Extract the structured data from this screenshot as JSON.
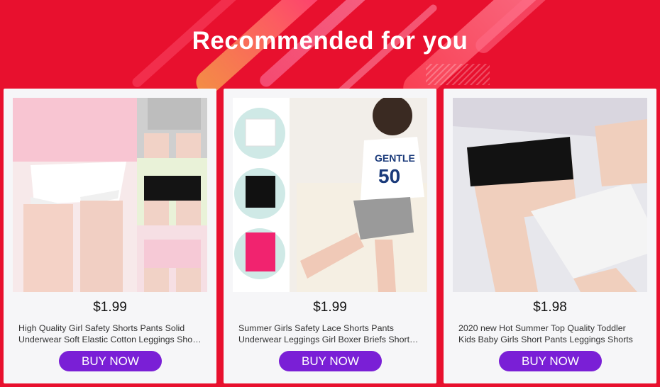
{
  "header": {
    "title": "Recommended for you"
  },
  "products": [
    {
      "price": "$1.99",
      "name": "High Quality Girl Safety Shorts Pants Solid Underwear Soft Elastic Cotton Leggings Short Pants",
      "button_label": "BUY NOW",
      "image_alt": "lace-trim safety shorts in white, grey, black, pink"
    },
    {
      "price": "$1.99",
      "name": "Summer Girls Safety Lace Shorts Pants Underwear Leggings Girl Boxer Briefs Short Pants",
      "button_label": "BUY NOW",
      "image_alt": "girl wearing grey shorts with white, black, pink variants"
    },
    {
      "price": "$1.98",
      "name": "2020 new Hot Summer Top Quality Toddler Kids Baby Girls Short Pants Leggings Shorts",
      "button_label": "BUY NOW",
      "image_alt": "black and white lace shorts on bed"
    }
  ],
  "colors": {
    "background": "#e8102e",
    "button": "#7a1fd6",
    "card": "#f6f6f8"
  }
}
